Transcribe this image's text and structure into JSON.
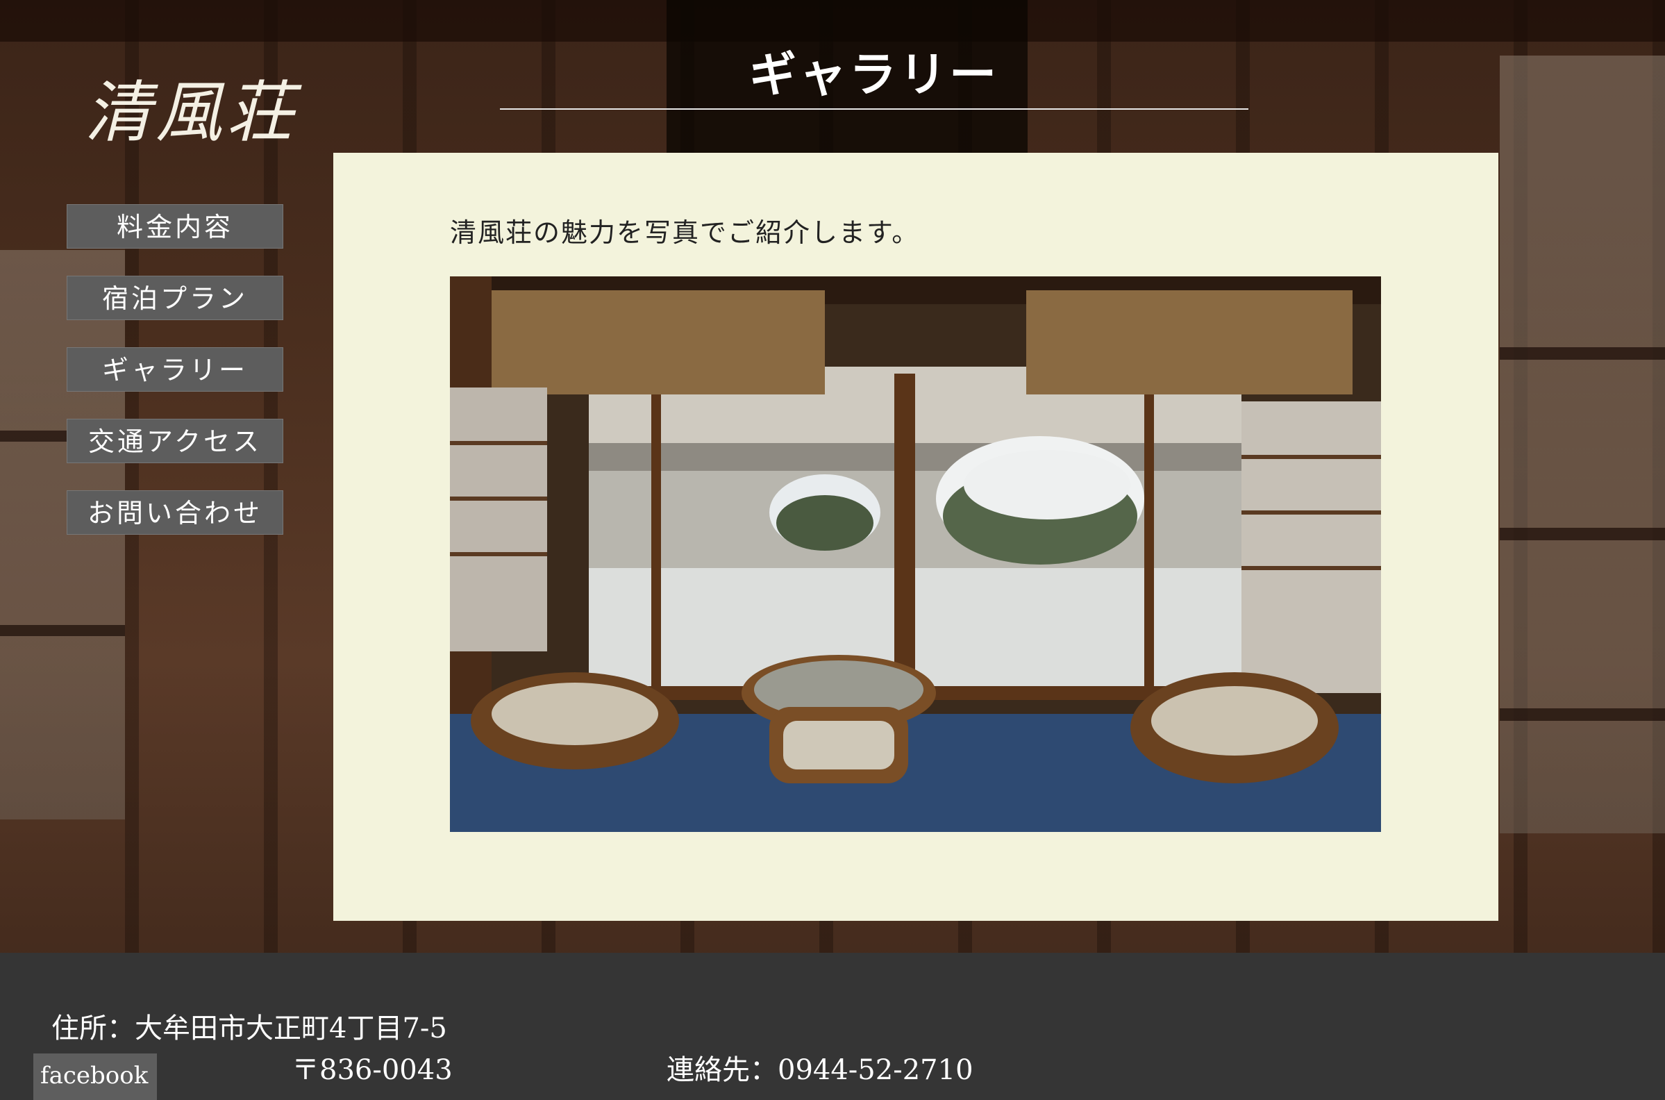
{
  "logo": {
    "text": "清風荘"
  },
  "header": {
    "title": "ギャラリー"
  },
  "nav": {
    "items": [
      {
        "label": "料金内容"
      },
      {
        "label": "宿泊プラン"
      },
      {
        "label": "ギャラリー"
      },
      {
        "label": "交通アクセス"
      },
      {
        "label": "お問い合わせ"
      }
    ]
  },
  "main": {
    "intro": "清風荘の魅力を写真でご紹介します。",
    "photo": {
      "subject": "snowy-garden-room-photo"
    }
  },
  "footer": {
    "address_line1": "住所：大牟田市大正町4丁目7-5",
    "address_line2": "〒836-0043",
    "contact": "連絡先：0944-52-2710",
    "facebook_label": "facebook"
  },
  "colors": {
    "content_bg": "#f3f3dc",
    "nav_bg": "#5d5d5d",
    "footer_bg": "#353535"
  }
}
